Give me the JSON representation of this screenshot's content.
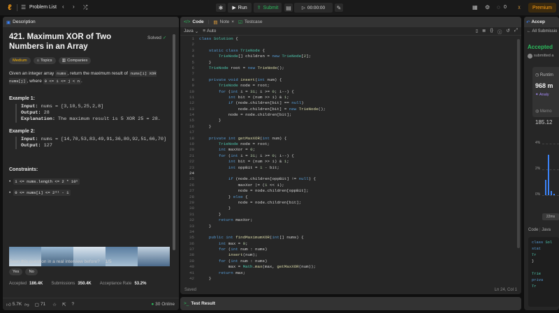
{
  "topbar": {
    "problem_list": "Problem List",
    "run": "Run",
    "submit": "Submit",
    "timer": "00:00:00",
    "streak": "0",
    "premium": "Premium"
  },
  "description": {
    "tab": "Description",
    "title": "421. Maximum XOR of Two Numbers in an Array",
    "solved": "Solved",
    "difficulty": "Medium",
    "topics": "Topics",
    "companies": "Companies",
    "p1": "Given an integer array ",
    "nums": "nums",
    "p2": ", return the maximum result of ",
    "expr": "nums[i] XOR nums[j]",
    "p3": ", where ",
    "cond": "0 <= i <= j < n",
    "p4": ".",
    "ex1_title": "Example 1:",
    "ex1_input": "nums = [3,10,5,25,2,8]",
    "ex1_output": "28",
    "ex1_expl": "The maximum result is 5 XOR 25 = 28.",
    "ex2_title": "Example 2:",
    "ex2_input": "nums = [14,70,53,83,49,91,36,80,92,51,66,70]",
    "ex2_output": "127",
    "input_label": "Input:",
    "output_label": "Output:",
    "expl_label": "Explanation:",
    "constraints_title": "Constraints:",
    "c1": "1 <= nums.length <= 2 * 10⁵",
    "c2": "0 <= nums[i] <= 2³¹ - 1",
    "interview_q": "Seen this question in a real interview before?",
    "interview_count": "1/5",
    "yes": "Yes",
    "no": "No",
    "accepted_label": "Accepted",
    "accepted_val": "186.4K",
    "subs_label": "Submissions",
    "subs_val": "350.4K",
    "rate_label": "Acceptance Rate",
    "rate_val": "53.2%",
    "likes": "5.7K",
    "comments": "71",
    "online": "30 Online"
  },
  "code": {
    "tab": "Code",
    "note": "Note",
    "testcase": "Testcase",
    "lang": "Java",
    "auto": "Auto",
    "saved": "Saved",
    "cursor": "Ln 24, Col 1"
  },
  "test_result": {
    "tab": "Test Result"
  },
  "right": {
    "tab": "Accep",
    "back": "All Submissio",
    "accepted": "Accepted",
    "submitted": "submitted a",
    "runtime": "Runtim",
    "runtime_val": "968 m",
    "analyze": "Analy",
    "memory": "Memo",
    "memory_val": "185.12",
    "pct4": "4%",
    "pct2": "2%",
    "pct0": "0%",
    "ms": "22ms",
    "code_label": "Code",
    "java": "Java"
  }
}
